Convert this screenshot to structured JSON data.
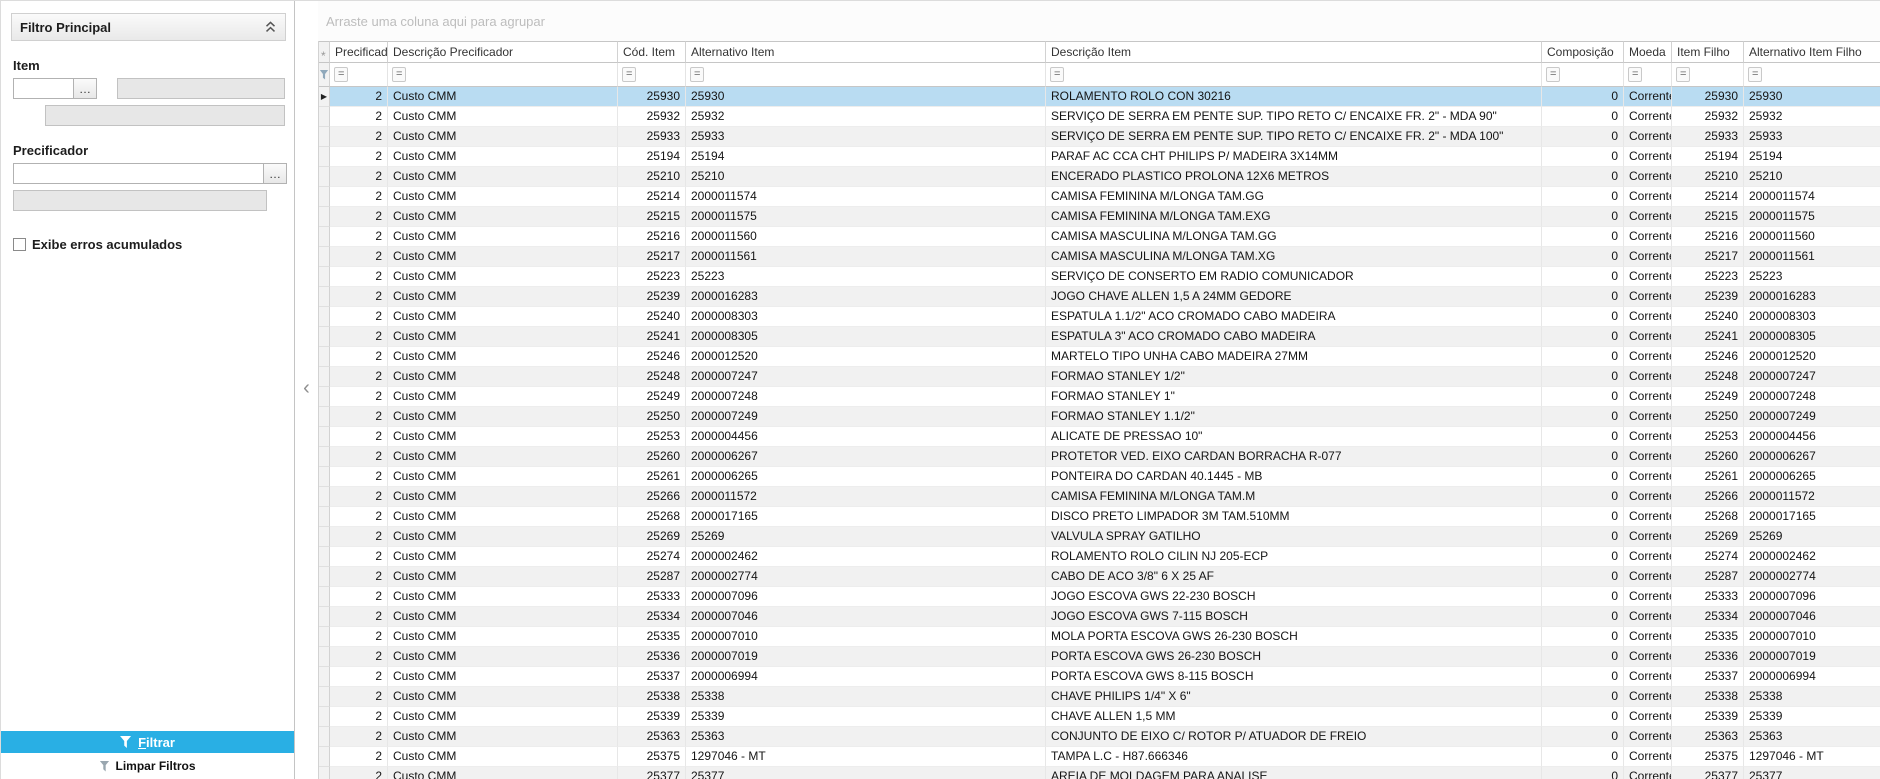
{
  "sidebar": {
    "title": "Filtro Principal",
    "item_label": "Item",
    "precificador_label": "Precificador",
    "checkbox_label": "Exibe erros acumulados",
    "checkbox_checked": false,
    "lookup_button": "…",
    "item_code_value": "",
    "precificador_value": "",
    "filtrar_button": "Filtrar",
    "limpar_filtros": "Limpar Filtros",
    "accent_color": "#29afe4"
  },
  "splitter": {
    "collapse_arrow": "‹"
  },
  "grid": {
    "group_hint": "Arraste uma coluna aqui para agrupar",
    "filter_operator": "=",
    "selected_row": 0,
    "columns": [
      "Precificador",
      "Descrição Precificador",
      "Cód. Item",
      "Alternativo Item",
      "Descrição Item",
      "Composição",
      "Moeda",
      "Item Filho",
      "Alternativo Item Filho"
    ],
    "rows": [
      [
        "2",
        "Custo CMM",
        "25930",
        "25930",
        "ROLAMENTO ROLO CON 30216",
        "0",
        "Corrente",
        "25930",
        "25930"
      ],
      [
        "2",
        "Custo CMM",
        "25932",
        "25932",
        "SERVIÇO DE SERRA EM PENTE SUP. TIPO RETO C/ ENCAIXE FR. 2\" - MDA 90\"",
        "0",
        "Corrente",
        "25932",
        "25932"
      ],
      [
        "2",
        "Custo CMM",
        "25933",
        "25933",
        "SERVIÇO DE SERRA EM PENTE SUP. TIPO RETO C/ ENCAIXE FR. 2\" - MDA 100\"",
        "0",
        "Corrente",
        "25933",
        "25933"
      ],
      [
        "2",
        "Custo CMM",
        "25194",
        "25194",
        "PARAF AC CCA CHT PHILIPS P/ MADEIRA 3X14MM",
        "0",
        "Corrente",
        "25194",
        "25194"
      ],
      [
        "2",
        "Custo CMM",
        "25210",
        "25210",
        "ENCERADO PLASTICO PROLONA 12X6 METROS",
        "0",
        "Corrente",
        "25210",
        "25210"
      ],
      [
        "2",
        "Custo CMM",
        "25214",
        "2000011574",
        "CAMISA FEMININA M/LONGA TAM.GG",
        "0",
        "Corrente",
        "25214",
        "2000011574"
      ],
      [
        "2",
        "Custo CMM",
        "25215",
        "2000011575",
        "CAMISA FEMININA M/LONGA TAM.EXG",
        "0",
        "Corrente",
        "25215",
        "2000011575"
      ],
      [
        "2",
        "Custo CMM",
        "25216",
        "2000011560",
        "CAMISA MASCULINA M/LONGA TAM.GG",
        "0",
        "Corrente",
        "25216",
        "2000011560"
      ],
      [
        "2",
        "Custo CMM",
        "25217",
        "2000011561",
        "CAMISA MASCULINA M/LONGA TAM.XG",
        "0",
        "Corrente",
        "25217",
        "2000011561"
      ],
      [
        "2",
        "Custo CMM",
        "25223",
        "25223",
        "SERVIÇO DE CONSERTO EM RADIO COMUNICADOR",
        "0",
        "Corrente",
        "25223",
        "25223"
      ],
      [
        "2",
        "Custo CMM",
        "25239",
        "2000016283",
        "JOGO CHAVE ALLEN 1,5 A 24MM GEDORE",
        "0",
        "Corrente",
        "25239",
        "2000016283"
      ],
      [
        "2",
        "Custo CMM",
        "25240",
        "2000008303",
        "ESPATULA 1.1/2\" ACO CROMADO CABO MADEIRA",
        "0",
        "Corrente",
        "25240",
        "2000008303"
      ],
      [
        "2",
        "Custo CMM",
        "25241",
        "2000008305",
        "ESPATULA 3\" ACO CROMADO CABO MADEIRA",
        "0",
        "Corrente",
        "25241",
        "2000008305"
      ],
      [
        "2",
        "Custo CMM",
        "25246",
        "2000012520",
        "MARTELO TIPO UNHA CABO MADEIRA 27MM",
        "0",
        "Corrente",
        "25246",
        "2000012520"
      ],
      [
        "2",
        "Custo CMM",
        "25248",
        "2000007247",
        "FORMAO STANLEY 1/2\"",
        "0",
        "Corrente",
        "25248",
        "2000007247"
      ],
      [
        "2",
        "Custo CMM",
        "25249",
        "2000007248",
        "FORMAO STANLEY 1\"",
        "0",
        "Corrente",
        "25249",
        "2000007248"
      ],
      [
        "2",
        "Custo CMM",
        "25250",
        "2000007249",
        "FORMAO STANLEY 1.1/2\"",
        "0",
        "Corrente",
        "25250",
        "2000007249"
      ],
      [
        "2",
        "Custo CMM",
        "25253",
        "2000004456",
        "ALICATE DE PRESSAO 10\"",
        "0",
        "Corrente",
        "25253",
        "2000004456"
      ],
      [
        "2",
        "Custo CMM",
        "25260",
        "2000006267",
        "PROTETOR VED. EIXO CARDAN BORRACHA R-077",
        "0",
        "Corrente",
        "25260",
        "2000006267"
      ],
      [
        "2",
        "Custo CMM",
        "25261",
        "2000006265",
        "PONTEIRA DO CARDAN 40.1445 - MB",
        "0",
        "Corrente",
        "25261",
        "2000006265"
      ],
      [
        "2",
        "Custo CMM",
        "25266",
        "2000011572",
        "CAMISA FEMININA M/LONGA TAM.M",
        "0",
        "Corrente",
        "25266",
        "2000011572"
      ],
      [
        "2",
        "Custo CMM",
        "25268",
        "2000017165",
        "DISCO PRETO LIMPADOR 3M TAM.510MM",
        "0",
        "Corrente",
        "25268",
        "2000017165"
      ],
      [
        "2",
        "Custo CMM",
        "25269",
        "25269",
        "VALVULA SPRAY GATILHO",
        "0",
        "Corrente",
        "25269",
        "25269"
      ],
      [
        "2",
        "Custo CMM",
        "25274",
        "2000002462",
        "ROLAMENTO ROLO CILIN NJ 205-ECP",
        "0",
        "Corrente",
        "25274",
        "2000002462"
      ],
      [
        "2",
        "Custo CMM",
        "25287",
        "2000002774",
        "CABO DE ACO 3/8\" 6 X 25 AF",
        "0",
        "Corrente",
        "25287",
        "2000002774"
      ],
      [
        "2",
        "Custo CMM",
        "25333",
        "2000007096",
        "JOGO ESCOVA GWS 22-230 BOSCH",
        "0",
        "Corrente",
        "25333",
        "2000007096"
      ],
      [
        "2",
        "Custo CMM",
        "25334",
        "2000007046",
        "JOGO ESCOVA GWS 7-115 BOSCH",
        "0",
        "Corrente",
        "25334",
        "2000007046"
      ],
      [
        "2",
        "Custo CMM",
        "25335",
        "2000007010",
        "MOLA PORTA ESCOVA GWS 26-230 BOSCH",
        "0",
        "Corrente",
        "25335",
        "2000007010"
      ],
      [
        "2",
        "Custo CMM",
        "25336",
        "2000007019",
        "PORTA ESCOVA GWS 26-230 BOSCH",
        "0",
        "Corrente",
        "25336",
        "2000007019"
      ],
      [
        "2",
        "Custo CMM",
        "25337",
        "2000006994",
        "PORTA ESCOVA GWS 8-115 BOSCH",
        "0",
        "Corrente",
        "25337",
        "2000006994"
      ],
      [
        "2",
        "Custo CMM",
        "25338",
        "25338",
        "CHAVE PHILIPS 1/4\" X 6\"",
        "0",
        "Corrente",
        "25338",
        "25338"
      ],
      [
        "2",
        "Custo CMM",
        "25339",
        "25339",
        "CHAVE ALLEN 1,5 MM",
        "0",
        "Corrente",
        "25339",
        "25339"
      ],
      [
        "2",
        "Custo CMM",
        "25363",
        "25363",
        "CONJUNTO DE EIXO C/ ROTOR P/ ATUADOR DE FREIO",
        "0",
        "Corrente",
        "25363",
        "25363"
      ],
      [
        "2",
        "Custo CMM",
        "25375",
        "1297046 - MT",
        "TAMPA L.C - H87.666346",
        "0",
        "Corrente",
        "25375",
        "1297046 - MT"
      ],
      [
        "2",
        "Custo CMM",
        "25377",
        "25377",
        "AREIA DE MOLDAGEM PARA ANALISE",
        "0",
        "Corrente",
        "25377",
        "25377"
      ]
    ]
  }
}
